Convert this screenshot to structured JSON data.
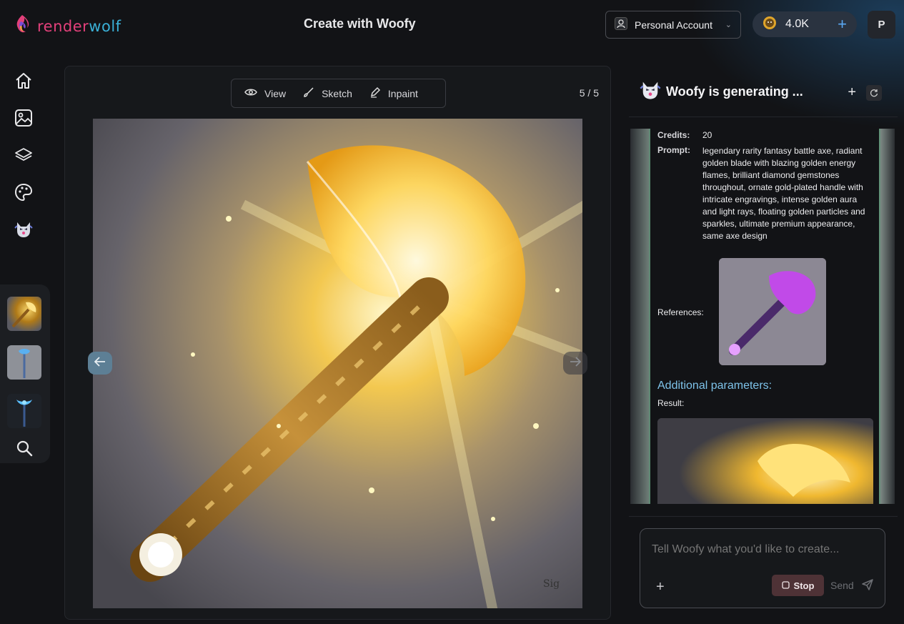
{
  "app": {
    "logo_part1": "render",
    "logo_part2": "wolf"
  },
  "header": {
    "title": "Create with Woofy",
    "account_label": "Personal Account",
    "credits": "4.0K",
    "avatar_initial": "P"
  },
  "nav": {
    "items": [
      "home-icon",
      "image-icon",
      "layers-icon",
      "palette-icon",
      "woofy-icon"
    ]
  },
  "canvas": {
    "tools": [
      {
        "label": "View",
        "icon": "eye-icon"
      },
      {
        "label": "Sketch",
        "icon": "brush-icon"
      },
      {
        "label": "Inpaint",
        "icon": "pen-icon"
      }
    ],
    "counter": "5 / 5"
  },
  "chat": {
    "title": "Woofy is generating ...",
    "credits_label": "Credits:",
    "credits_value": "20",
    "prompt_label": "Prompt:",
    "prompt_value": "legendary rarity fantasy battle axe, radiant golden blade with blazing golden energy flames, brilliant diamond gemstones throughout, ornate gold-plated handle with intricate engravings, intense golden aura and light rays, floating golden particles and sparkles, ultimate premium appearance, same axe design",
    "references_label": "References:",
    "additional_label": "Additional parameters:",
    "result_label": "Result:"
  },
  "composer": {
    "placeholder": "Tell Woofy what you'd like to create...",
    "stop_label": "Stop",
    "send_label": "Send"
  },
  "colors": {
    "accent_blue": "#5aa9f5",
    "link": "#7ec3ea",
    "logo_pink": "#e2407a",
    "logo_cyan": "#3ab0d6"
  }
}
